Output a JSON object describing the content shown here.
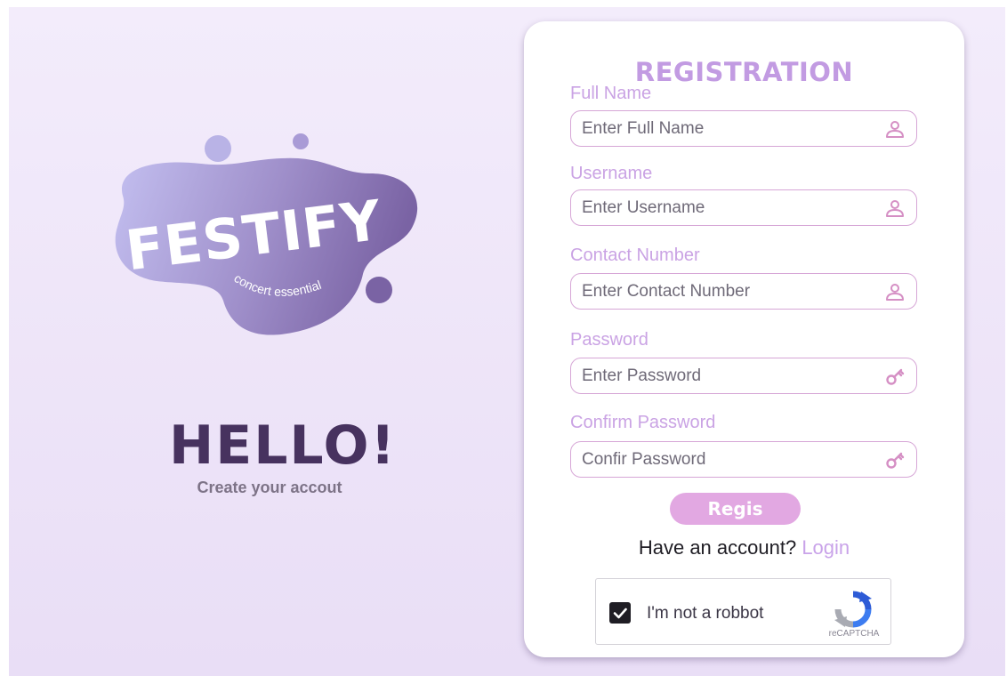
{
  "logo": {
    "wordmark": "FESTIFY",
    "tagline": "concert essential"
  },
  "hero": {
    "greeting": "HELLO!",
    "subtitle": "Create your accout"
  },
  "form": {
    "title": "REGISTRATION",
    "fields": [
      {
        "label": "Full Name",
        "placeholder": "Enter Full Name",
        "icon": "user-icon"
      },
      {
        "label": "Username",
        "placeholder": "Enter Username",
        "icon": "user-icon"
      },
      {
        "label": "Contact Number",
        "placeholder": "Enter Contact Number",
        "icon": "user-icon"
      },
      {
        "label": "Password",
        "placeholder": "Enter Password",
        "icon": "key-icon"
      },
      {
        "label": "Confirm Password",
        "placeholder": "Confir Password",
        "icon": "key-icon"
      }
    ],
    "submit_label": "Regis",
    "account_prompt": "Have an account?",
    "login_label": "Login"
  },
  "captcha": {
    "label": "I'm not a robbot",
    "checked": true,
    "brand": "reCAPTCHA"
  },
  "colors": {
    "accent": "#c29be2",
    "button": "#e2a8e2",
    "heading_dark": "#47325f",
    "logo_gradient_start": "#c0bcef",
    "logo_gradient_end": "#7b64a5"
  }
}
